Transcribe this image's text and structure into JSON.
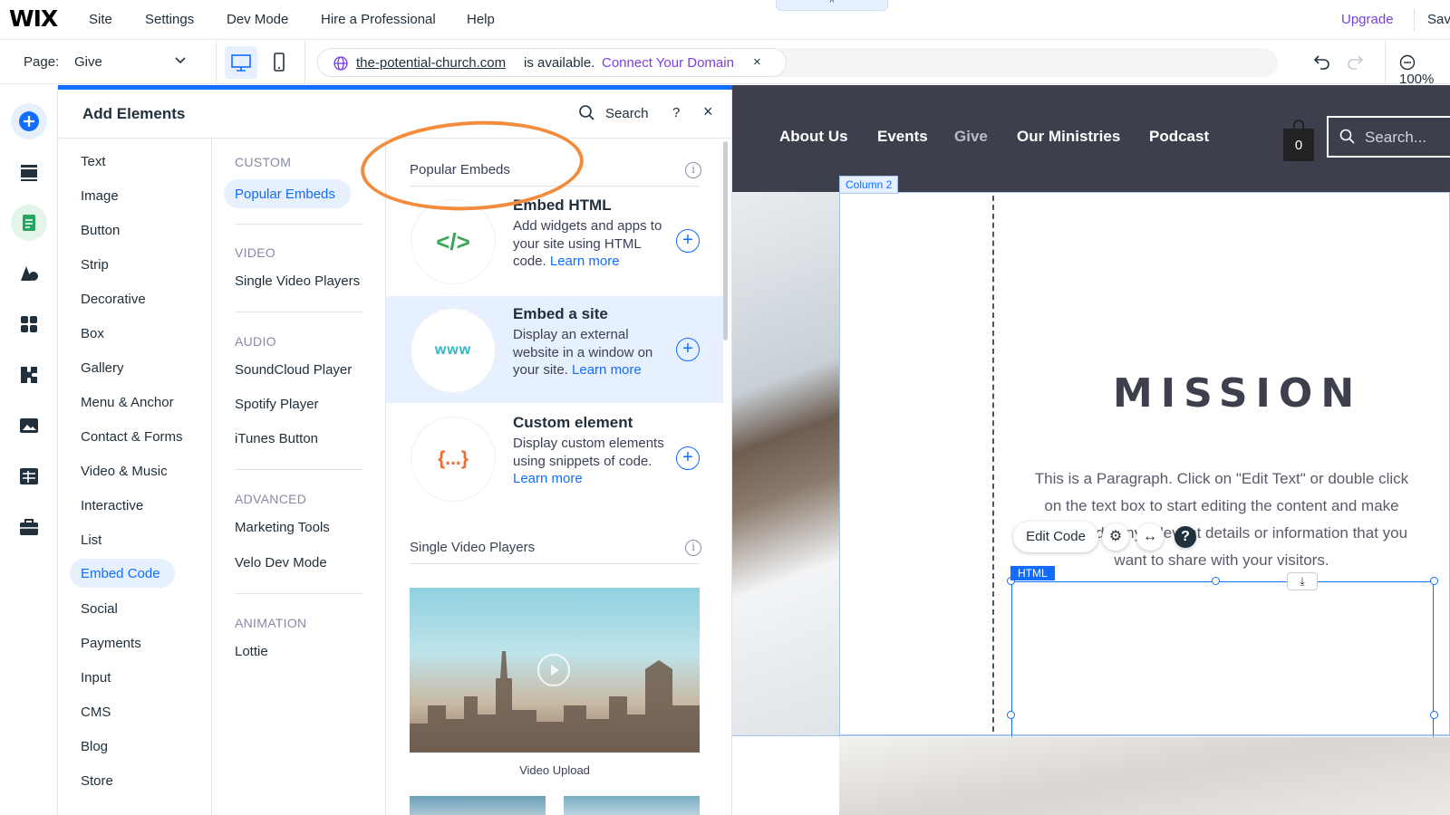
{
  "topbar": {
    "logo": "WIX",
    "menu": [
      "Site",
      "Settings",
      "Dev Mode",
      "Hire a Professional",
      "Help"
    ],
    "upgrade": "Upgrade",
    "save": "Sav",
    "collapse_glyph": "^"
  },
  "toolbar": {
    "page_label": "Page:",
    "page_value": "Give",
    "domain_name": "the-potential-church.com",
    "domain_status": "is available.",
    "connect_domain": "Connect Your Domain",
    "close_glyph": "×",
    "zoom": "100%"
  },
  "rail": {
    "icons": [
      "add-icon",
      "menus-icon",
      "pages-icon",
      "design-icon",
      "apps-icon",
      "app-market-icon",
      "media-icon",
      "cms-icon",
      "business-icon"
    ],
    "accent": "#116dff",
    "pages_accent": "#25a55f"
  },
  "panel": {
    "title": "Add Elements",
    "search": "Search",
    "help": "?",
    "close": "×",
    "categories": [
      "Text",
      "Image",
      "Button",
      "Strip",
      "Decorative",
      "Box",
      "Gallery",
      "Menu & Anchor",
      "Contact & Forms",
      "Video & Music",
      "Interactive",
      "List",
      "Embed Code",
      "Social",
      "Payments",
      "Input",
      "CMS",
      "Blog",
      "Store"
    ],
    "active_category": "Embed Code",
    "subsections": [
      {
        "heading": "CUSTOM",
        "items": [
          "Popular Embeds"
        ]
      },
      {
        "heading": "VIDEO",
        "items": [
          "Single Video Players"
        ]
      },
      {
        "heading": "AUDIO",
        "items": [
          "SoundCloud Player",
          "Spotify Player",
          "iTunes Button"
        ]
      },
      {
        "heading": "ADVANCED",
        "items": [
          "Marketing Tools",
          "Velo Dev Mode"
        ]
      },
      {
        "heading": "ANIMATION",
        "items": [
          "Lottie"
        ]
      }
    ],
    "popular_title": "Popular Embeds",
    "embeds": [
      {
        "title": "Embed HTML",
        "desc": "Add widgets and apps to your site using HTML code.",
        "learn": "Learn more",
        "icon": "</>",
        "icon_color": "#3aa658"
      },
      {
        "title": "Embed a site",
        "desc": "Display an external website in a window on your site.",
        "learn": "Learn more",
        "icon": "www",
        "icon_color": "#2fb8c4"
      },
      {
        "title": "Custom element",
        "desc": "Display custom elements using snippets of code.",
        "learn": "Learn more",
        "icon": "{...}",
        "icon_color": "#f26a2b"
      }
    ],
    "video_title": "Single Video Players",
    "video_caption": "Video Upload",
    "info_glyph": "i"
  },
  "site": {
    "nav": [
      "About Us",
      "Events",
      "Give",
      "Our Ministries",
      "Podcast"
    ],
    "cart_count": "0",
    "search_placeholder": "Search...",
    "column_tag": "Column 2",
    "mission": "MISSION",
    "paragraph": "This is a Paragraph. Click on \"Edit Text\" or double click on the text box to start editing the content and make sure to add any relevant details or information that you want to share with your visitors.",
    "edit_code": "Edit Code",
    "html_tag": "HTML"
  }
}
